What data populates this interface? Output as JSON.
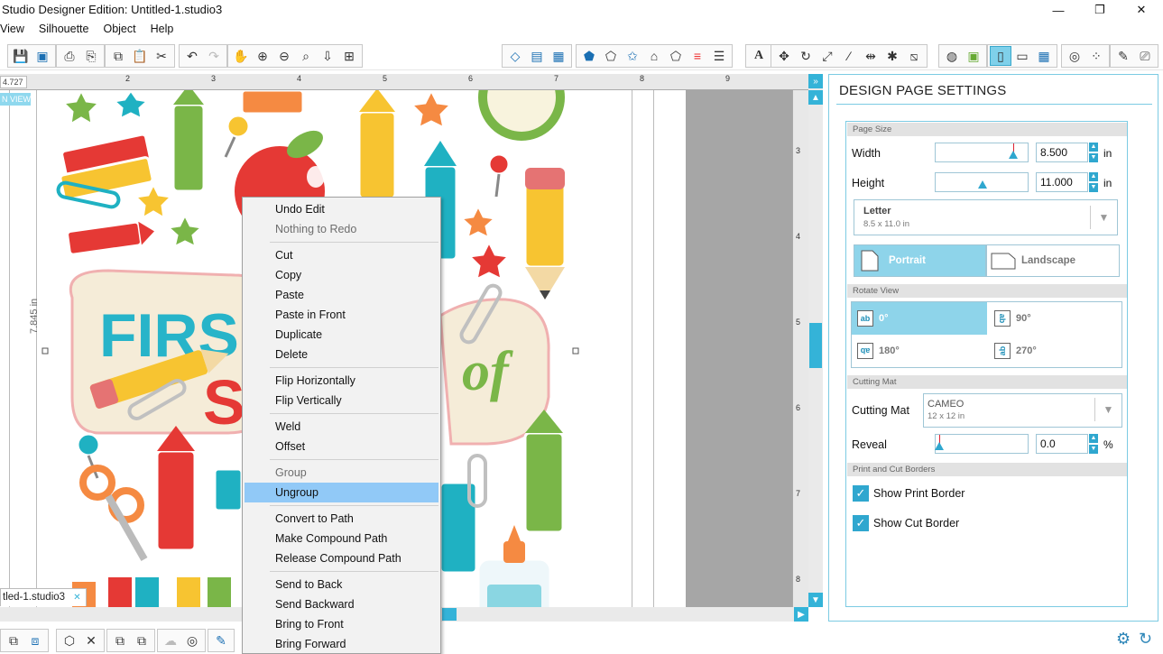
{
  "window": {
    "title": "Studio Designer Edition: Untitled-1.studio3",
    "minimize": "—",
    "maximize": "❐",
    "close": "✕"
  },
  "menu": [
    "View",
    "Silhouette",
    "Object",
    "Help"
  ],
  "ruler": {
    "coord": "4.727",
    "top_ticks": [
      "2",
      "3",
      "4",
      "5",
      "6",
      "7",
      "8",
      "9"
    ],
    "right_ticks": [
      "3",
      "4",
      "5",
      "6",
      "7",
      "8"
    ],
    "page_dimension": "7.845 in",
    "view_label": "N VIEW"
  },
  "document_tab": {
    "name": "tled-1.studio3",
    "close": "✕"
  },
  "context_menu": {
    "items": [
      {
        "label": "Undo Edit",
        "state": "normal"
      },
      {
        "label": "Nothing to Redo",
        "state": "disabled"
      },
      {
        "label": "Cut",
        "state": "normal"
      },
      {
        "label": "Copy",
        "state": "normal"
      },
      {
        "label": "Paste",
        "state": "normal"
      },
      {
        "label": "Paste in Front",
        "state": "normal"
      },
      {
        "label": "Duplicate",
        "state": "normal"
      },
      {
        "label": "Delete",
        "state": "normal"
      },
      {
        "label": "Flip Horizontally",
        "state": "normal"
      },
      {
        "label": "Flip Vertically",
        "state": "normal"
      },
      {
        "label": "Weld",
        "state": "normal"
      },
      {
        "label": "Offset",
        "state": "normal"
      },
      {
        "label": "Group",
        "state": "disabled"
      },
      {
        "label": "Ungroup",
        "state": "highlighted"
      },
      {
        "label": "Convert to Path",
        "state": "normal"
      },
      {
        "label": "Make Compound Path",
        "state": "normal"
      },
      {
        "label": "Release Compound Path",
        "state": "normal"
      },
      {
        "label": "Send to Back",
        "state": "normal"
      },
      {
        "label": "Send Backward",
        "state": "normal"
      },
      {
        "label": "Bring to Front",
        "state": "normal"
      },
      {
        "label": "Bring Forward",
        "state": "normal"
      }
    ]
  },
  "panel": {
    "title": "DESIGN PAGE SETTINGS",
    "page_size": {
      "section": "Page Size",
      "width_label": "Width",
      "width_value": "8.500",
      "height_label": "Height",
      "height_value": "11.000",
      "unit": "in",
      "preset_name": "Letter",
      "preset_dims": "8.5 x 11.0 in",
      "portrait": "Portrait",
      "landscape": "Landscape",
      "selected_orientation": "Portrait"
    },
    "rotate_view": {
      "section": "Rotate View",
      "options": [
        "0°",
        "90°",
        "180°",
        "270°"
      ],
      "selected": "0°"
    },
    "cutting_mat": {
      "section": "Cutting Mat",
      "label": "Cutting Mat",
      "mat_name": "CAMEO",
      "mat_dims": "12 x 12 in",
      "reveal_label": "Reveal",
      "reveal_value": "0.0",
      "reveal_unit": "%"
    },
    "borders": {
      "section": "Print and Cut Borders",
      "print_border": "Show Print Border",
      "cut_border": "Show Cut Border",
      "print_checked": true,
      "cut_checked": true
    }
  },
  "colors": {
    "accent": "#2fa7cf",
    "selection": "#8ed4ea",
    "menu_highlight": "#91c9f7"
  }
}
